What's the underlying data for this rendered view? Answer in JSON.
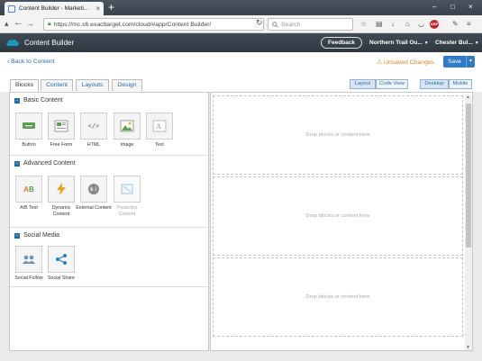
{
  "browser": {
    "tab_title": "Content Builder - Marketi...",
    "url": "https://mc.s6.exacttarget.com/cloud/#app/Content Builder/",
    "search_placeholder": "Search"
  },
  "header": {
    "app_title": "Content Builder",
    "feedback_label": "Feedback",
    "business_unit_1": "Northern Trail Ou...",
    "business_unit_2": "Chester Bul..."
  },
  "subheader": {
    "back_label": "Back to Content",
    "unsaved_label": "Unsaved Changes",
    "save_label": "Save"
  },
  "content_tabs": [
    "Blocks",
    "Content",
    "Layouts",
    "Design"
  ],
  "view_toggle": {
    "layout": "Layout",
    "code": "Code View"
  },
  "device_toggle": {
    "desktop": "Desktop",
    "mobile": "Mobile"
  },
  "sections": [
    {
      "title": "Basic Content",
      "blocks": [
        {
          "label": "Button",
          "icon": "button-block-icon"
        },
        {
          "label": "Free Form",
          "icon": "free-form-icon"
        },
        {
          "label": "HTML",
          "icon": "html-icon"
        },
        {
          "label": "Image",
          "icon": "image-icon"
        },
        {
          "label": "Text",
          "icon": "text-icon"
        }
      ]
    },
    {
      "title": "Advanced Content",
      "blocks": [
        {
          "label": "A/B Test",
          "icon": "ab-test-icon"
        },
        {
          "label": "Dynamic Content",
          "icon": "dynamic-content-icon"
        },
        {
          "label": "External Content",
          "icon": "globe-icon"
        },
        {
          "label": "Predictive Content",
          "icon": "predictive-content-icon"
        }
      ]
    },
    {
      "title": "Social Media",
      "blocks": [
        {
          "label": "Social Follow",
          "icon": "social-follow-icon"
        },
        {
          "label": "Social Share",
          "icon": "share-icon"
        }
      ]
    }
  ],
  "canvas": {
    "drop_zones": [
      "Drop blocks or content here",
      "Drop blocks or content here",
      "Drop blocks or content here"
    ]
  },
  "colors": {
    "accent": "#2f7bc5",
    "warning": "#e27f1f",
    "header_bg": "#3f4a55"
  }
}
